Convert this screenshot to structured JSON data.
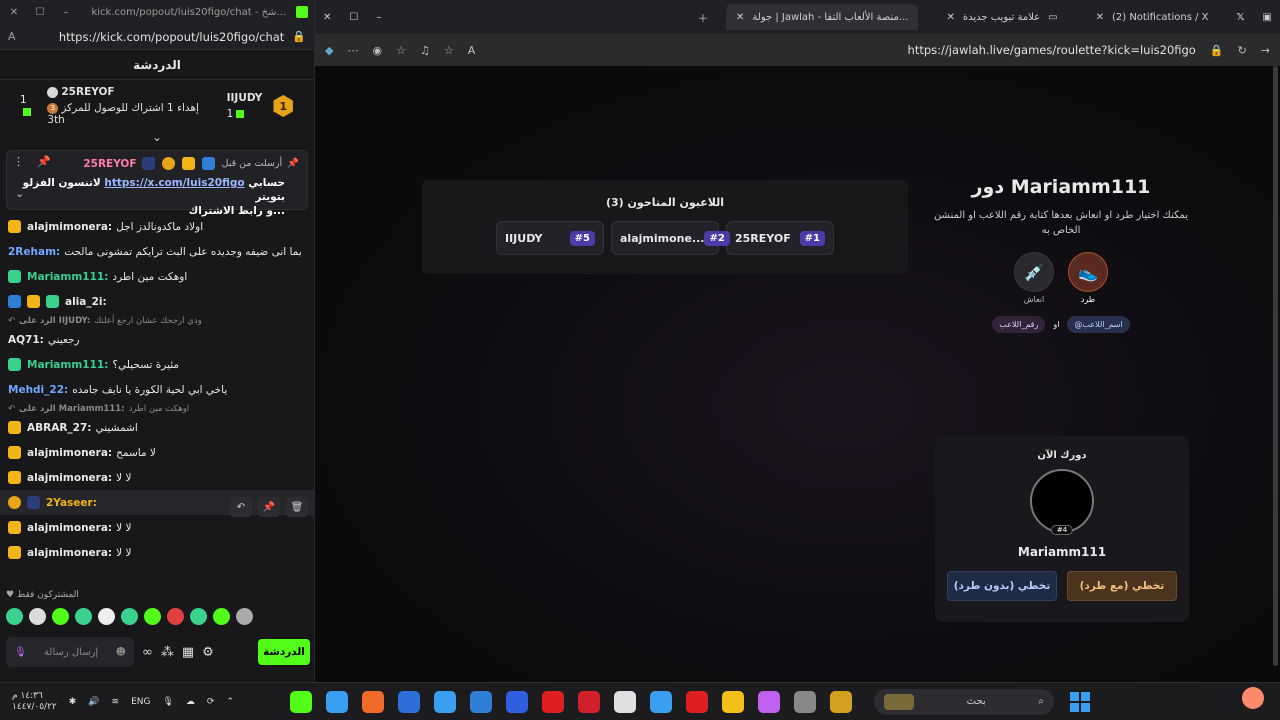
{
  "left_window": {
    "title": "kick.com/popout/luis20figo/chat - شخ...",
    "url": "https://kick.com/popout/luis20figo/chat",
    "chat_header": "الدردشة",
    "leaderboard": {
      "first_name": "IIJUDY",
      "first_rank": "1",
      "first_count": "1",
      "second_name": "25REYOF",
      "second_count": "1",
      "gift_text": "إهداء 1 اشتراك للوصول للمركز 3",
      "gift_suffix": "th",
      "bronze": "3"
    },
    "pinned": {
      "by_label": "أرسلت من قبل",
      "user": "25REYOF",
      "text_prefix": "لاتنسون الفزلو",
      "link": "https://x.com/luis20figo",
      "text_suffix": "حسابي بتويتر",
      "line2": "و رابط الاشتراك...",
      "badge_num": "1"
    },
    "messages": [
      {
        "user": "alajmimonera:",
        "text": "اولاد ماكدونالدز اجل",
        "color": "#e8e8e8",
        "badges": [
          "crown"
        ]
      },
      {
        "user": "2Reham:",
        "text": "بما انى ضيفه وجديده على البث ترايكم تمشونى مالحت",
        "color": "#6ea8ff",
        "badges": []
      },
      {
        "user": "Mariamm111:",
        "text": "اوهكت مين اطرد",
        "color": "#3ad18f",
        "badges": [
          "green"
        ]
      },
      {
        "user": "alia_2i:",
        "text": "",
        "color": "#e8e8e8",
        "badges": [
          "blue",
          "crown",
          "green"
        ]
      },
      {
        "user": "الرد على IIJUDY:",
        "text": "ودي ارجحك عشان ارجع أعلنك",
        "color": "#8a8a8a",
        "reply": true
      },
      {
        "user": "AQ71:",
        "text": "رجعيني",
        "color": "#e8e8e8",
        "badges": []
      },
      {
        "user": "Mariamm111:",
        "text": "مئيرة تسحيلي؟",
        "color": "#3ad18f",
        "badges": [
          "green"
        ]
      },
      {
        "user": "Mehdi_22:",
        "text": "ياخي ابي لحية الكورة يا نايف جامده",
        "color": "#6ea8ff",
        "badges": []
      },
      {
        "user": "الرد على Mariamm111:",
        "text": "اوهكت مين اطرد",
        "color": "#8a8a8a",
        "reply": true
      },
      {
        "user": "ABRAR_27:",
        "text": "اشمشيني",
        "color": "#e8e8e8",
        "badges": [
          "crown"
        ]
      },
      {
        "user": "alajmimonera:",
        "text": "لا ماسمح",
        "color": "#e8e8e8",
        "badges": [
          "crown"
        ]
      },
      {
        "user": "alajmimonera:",
        "text": "لا لا",
        "color": "#e8e8e8",
        "badges": [
          "crown"
        ]
      },
      {
        "user": "2Yaseer:",
        "text": "",
        "color": "#f2b518",
        "badges": [
          "gold",
          "navy"
        ],
        "highlight": true
      },
      {
        "user": "alajmimonera:",
        "text": "لا لا",
        "color": "#e8e8e8",
        "badges": [
          "crown"
        ]
      },
      {
        "user": "alajmimonera:",
        "text": "لا لا",
        "color": "#e8e8e8",
        "badges": [
          "crown"
        ]
      }
    ],
    "subs_only": "المشتركون فقط",
    "input_placeholder": "إرسال رسالة",
    "chat_button": "الدردشة",
    "emote_colors": [
      "#3ad18f",
      "#dddddd",
      "#53fc18",
      "#3ad18f",
      "#eeeeee",
      "#3ad18f",
      "#53fc18",
      "#e04040",
      "#3ad18f",
      "#53fc18",
      "#aaaaaa"
    ]
  },
  "browser": {
    "tabs": [
      {
        "label": "(2) Notifications / X"
      },
      {
        "label": "علامة تبويب جديدة"
      },
      {
        "label": "جولة | Jawlah - منصة الألعاب التفا..."
      }
    ],
    "url": "https://jawlah.live/games/roulette?kick=luis20figo"
  },
  "game": {
    "players_title": "اللاعبون المتاحون (3)",
    "players": [
      {
        "num": "#1",
        "name": "25REYOF"
      },
      {
        "num": "#2",
        "name": "alajmimone..."
      },
      {
        "num": "#5",
        "name": "IIJUDY"
      }
    ],
    "turn_title": "دور Mariamm111",
    "turn_desc": "يمكنك اختيار طرد او انعاش بعدها كتابة رقم اللاعب او المنشن الخاص به",
    "action_kick": "طرد",
    "action_revive": "انعاش",
    "mention_name": "@اسم_اللاعب",
    "mention_or": "او",
    "mention_num": "رقم_اللاعب",
    "now_label": "دورك الآن",
    "avatar_tag": "#4",
    "now_name": "Mariamm111",
    "skip_kick": "تخطي (مع طرد)",
    "skip_nokick": "تخطي (بدون طرد)"
  },
  "taskbar": {
    "time": "١٤:٣٦ م",
    "date": "١٤٤٧/٠٥/٢٢",
    "lang": "ENG",
    "search": "بحث",
    "app_colors": [
      "#53fc18",
      "#3a9ff0",
      "#f06a2a",
      "#2d6fd6",
      "#3a9ff0",
      "#2f7fd6",
      "#2f5fe0",
      "#e02020",
      "#d0202a",
      "#e0e0e0",
      "#3a9ff0",
      "#e02020",
      "#f2c018",
      "#c060f0",
      "#888888",
      "#d4a020"
    ]
  }
}
